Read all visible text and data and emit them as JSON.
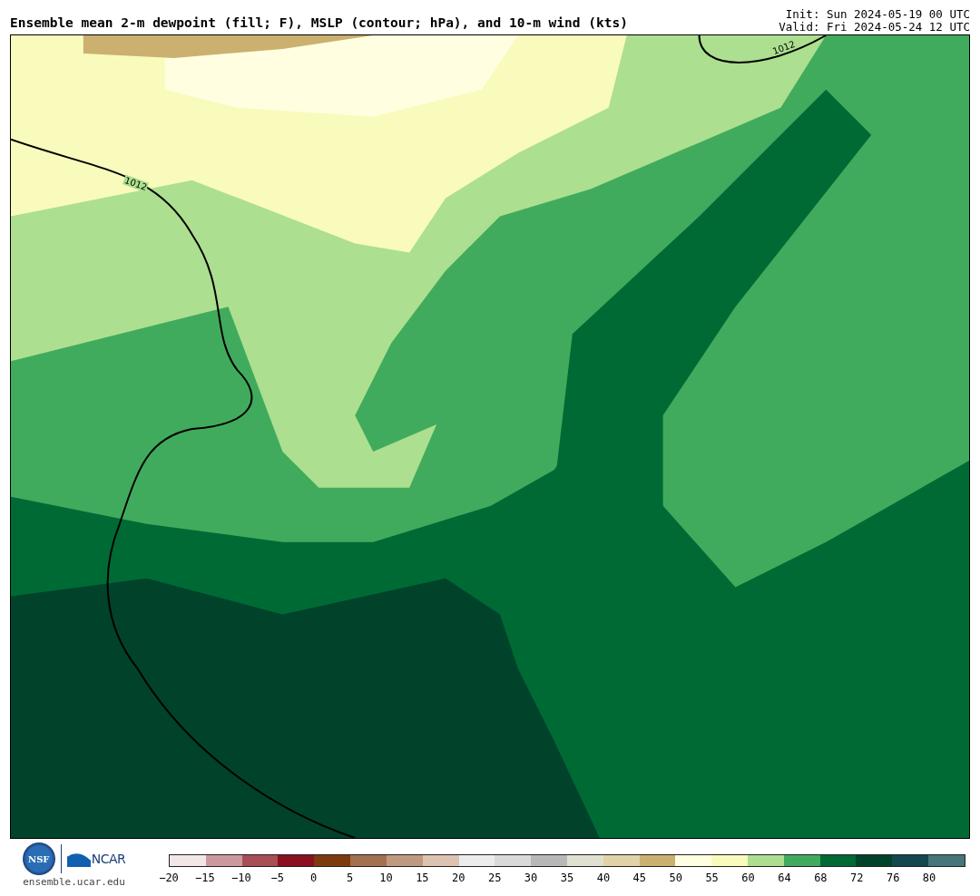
{
  "header": {
    "title": "Ensemble mean 2-m dewpoint (fill; F), MSLP (contour; hPa), and 10-m wind (kts)",
    "init": "Init: Sun 2024-05-19 00 UTC",
    "valid": "Valid: Fri 2024-05-24 12 UTC"
  },
  "map": {
    "contour_labels": [
      "1012",
      "1012"
    ]
  },
  "footer": {
    "nsf_logo": "NSF",
    "ncar_logo": "NCAR",
    "url": "ensemble.ucar.edu"
  },
  "colorbar": {
    "segments": [
      {
        "color": "#f3e6e6"
      },
      {
        "color": "#cc9a9e"
      },
      {
        "color": "#a84e55"
      },
      {
        "color": "#8b1020"
      },
      {
        "color": "#7e3a0f"
      },
      {
        "color": "#a4704f"
      },
      {
        "color": "#c09a80"
      },
      {
        "color": "#dcc3b1"
      },
      {
        "color": "#ececec"
      },
      {
        "color": "#d9d9d9"
      },
      {
        "color": "#b8b8b8"
      },
      {
        "color": "#e0e0d0"
      },
      {
        "color": "#e2d2a8"
      },
      {
        "color": "#ccb070"
      },
      {
        "color": "#fffee0"
      },
      {
        "color": "#f8fbbb"
      },
      {
        "color": "#acdf8f"
      },
      {
        "color": "#41ab5d"
      },
      {
        "color": "#006a35"
      },
      {
        "color": "#00432a"
      },
      {
        "color": "#14474f"
      },
      {
        "color": "#46757a"
      }
    ],
    "ticks": [
      "−20",
      "−15",
      "−10",
      "−5",
      "0",
      "5",
      "10",
      "15",
      "20",
      "25",
      "30",
      "35",
      "40",
      "45",
      "50",
      "55",
      "60",
      "64",
      "68",
      "72",
      "76",
      "80"
    ]
  }
}
